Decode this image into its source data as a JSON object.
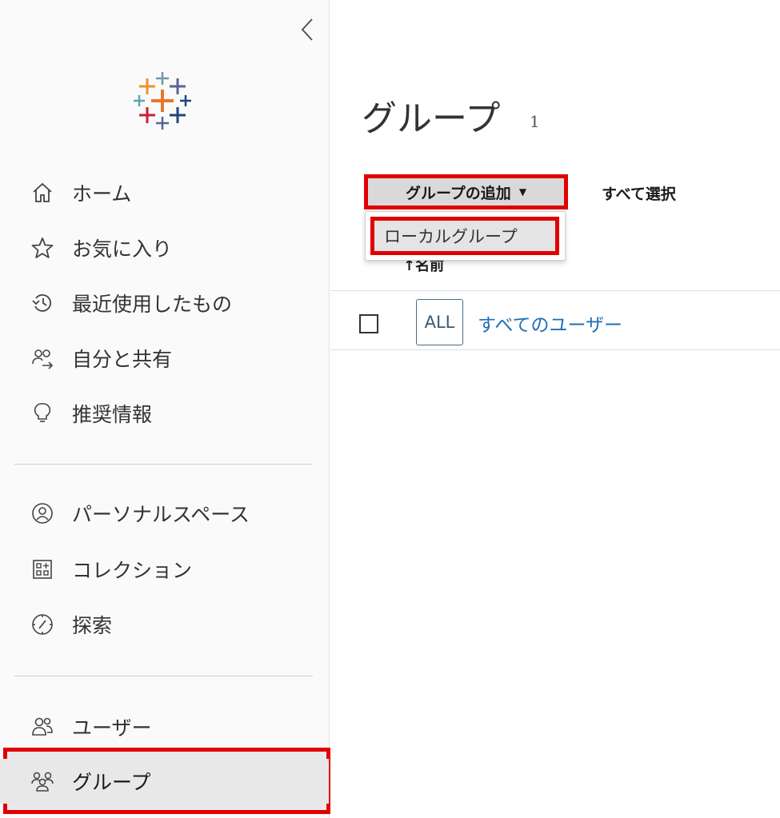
{
  "sidebar": {
    "nav_primary": [
      {
        "label": "ホーム",
        "icon": "home-icon"
      },
      {
        "label": "お気に入り",
        "icon": "star-icon"
      },
      {
        "label": "最近使用したもの",
        "icon": "recent-history-icon"
      },
      {
        "label": "自分と共有",
        "icon": "shared-users-icon"
      },
      {
        "label": "推奨情報",
        "icon": "lightbulb-icon"
      }
    ],
    "nav_secondary": [
      {
        "label": "パーソナルスペース",
        "icon": "personal-space-icon"
      },
      {
        "label": "コレクション",
        "icon": "collection-icon"
      },
      {
        "label": "探索",
        "icon": "compass-icon"
      }
    ],
    "nav_admin": [
      {
        "label": "ユーザー",
        "icon": "users-icon"
      },
      {
        "label": "グループ",
        "icon": "groups-icon",
        "active": true
      }
    ]
  },
  "main": {
    "title": "グループ",
    "count": "1",
    "toolbar": {
      "add_group_label": "グループの追加",
      "select_all_label": "すべて選択"
    },
    "dropdown": {
      "items": [
        "ローカルグループ"
      ]
    },
    "sort_label": "↑名前",
    "rows": [
      {
        "avatar": "ALL",
        "name": "すべてのユーザー"
      }
    ]
  },
  "colors": {
    "highlight": "#e10000",
    "link": "#1f6fb5",
    "sidebar_bg": "#fafafa",
    "active_bg": "#e8e8e8"
  }
}
